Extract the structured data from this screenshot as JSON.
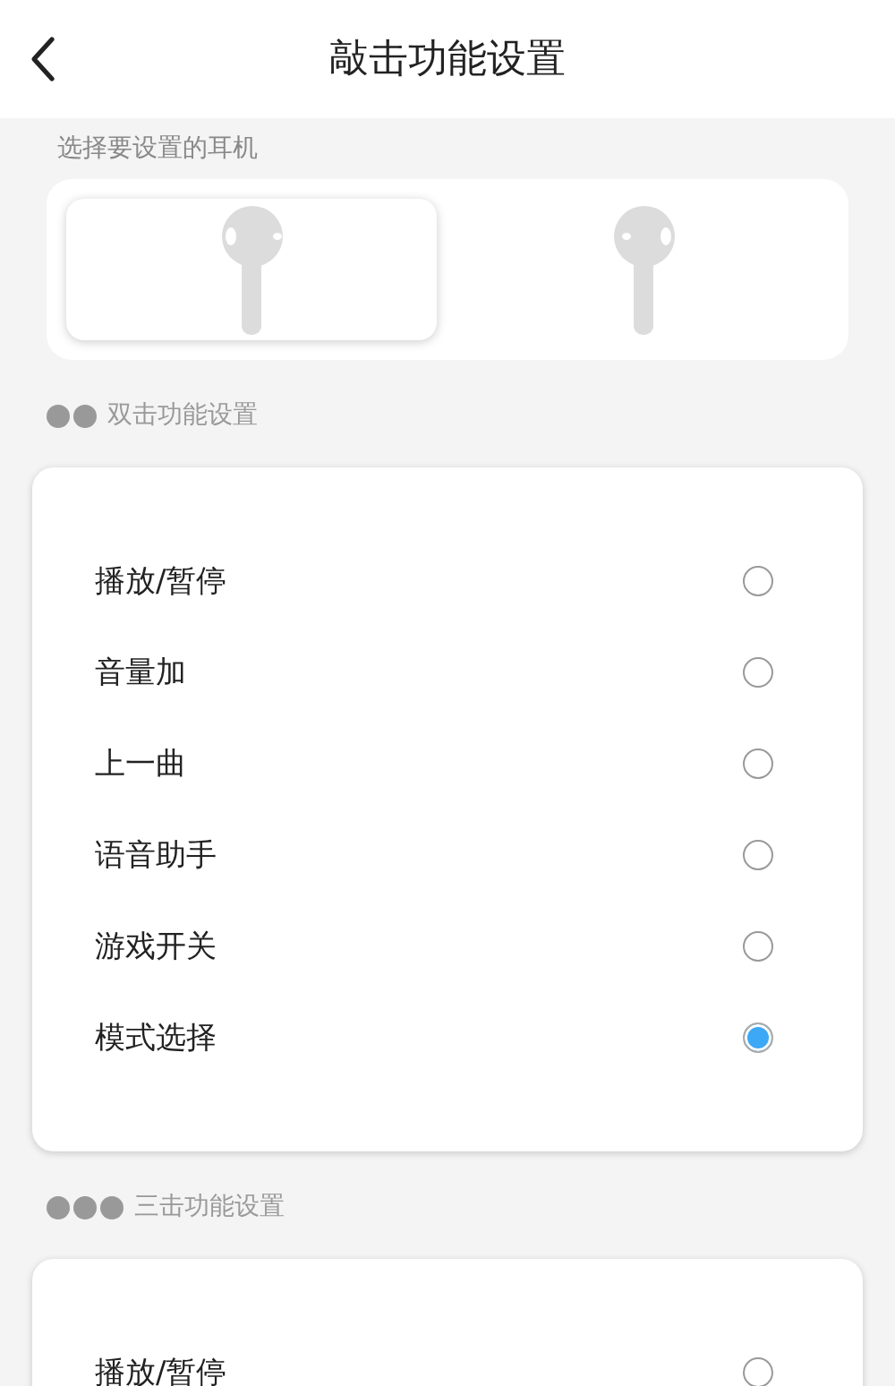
{
  "header": {
    "title": "敲击功能设置"
  },
  "earbud_picker": {
    "label": "选择要设置的耳机",
    "earbuds": [
      {
        "kind": "left",
        "selected": true
      },
      {
        "kind": "right",
        "selected": false
      }
    ]
  },
  "sections": [
    {
      "kind": "double",
      "title": "双击功能设置",
      "options": [
        {
          "label": "播放/暂停",
          "selected": false
        },
        {
          "label": "音量加",
          "selected": false
        },
        {
          "label": "上一曲",
          "selected": false
        },
        {
          "label": "语音助手",
          "selected": false
        },
        {
          "label": "游戏开关",
          "selected": false
        },
        {
          "label": "模式选择",
          "selected": true
        }
      ]
    },
    {
      "kind": "triple",
      "title": "三击功能设置",
      "options": [
        {
          "label": "播放/暂停",
          "selected": false
        }
      ]
    }
  ]
}
